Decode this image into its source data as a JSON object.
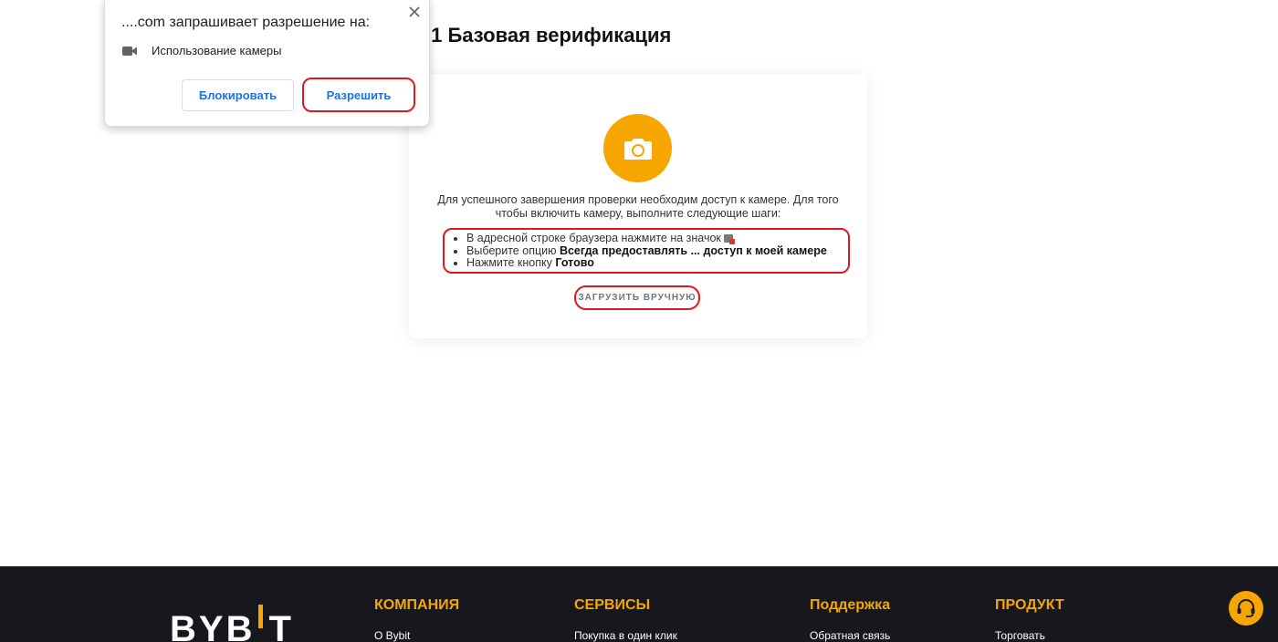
{
  "page": {
    "title": ".1 Базовая верификация"
  },
  "popup": {
    "title": "....com запрашивает разрешение на:",
    "permission_label": "Использование камеры",
    "permission_icon": "video-camera-icon",
    "block_label": "Блокировать",
    "allow_label": "Разрешить",
    "close_icon": "close-icon"
  },
  "card": {
    "camera_icon": "camera-icon",
    "info_text": "Для успешного завершения проверки необходим доступ к камере. Для того чтобы включить камеру, выполните следующие шаги:",
    "steps": [
      {
        "text": "В адресной строке браузера нажмите на значок",
        "bold": ""
      },
      {
        "text": "Выберите опцию ",
        "bold": "Всегда предоставлять ... доступ к моей камере"
      },
      {
        "text": "Нажмите кнопку ",
        "bold": "Готово"
      }
    ],
    "manual_upload_label": "ЗАГРУЗИТЬ ВРУЧНУЮ"
  },
  "footer": {
    "logo_text_left": "BYB",
    "logo_text_right": "T",
    "columns": [
      {
        "heading": "КОМПАНИЯ",
        "link": "О Bybit"
      },
      {
        "heading": "СЕРВИСЫ",
        "link": "Покупка в один клик"
      },
      {
        "heading": "Поддержка",
        "link": "Обратная связь"
      },
      {
        "heading": "ПРОДУКТ",
        "link": "Торговать"
      }
    ],
    "support_icon": "headset-icon"
  },
  "colors": {
    "accent": "#f7a600",
    "highlight": "#e0181c",
    "link_blue": "#1a73e8",
    "footer_bg": "#17181e"
  }
}
